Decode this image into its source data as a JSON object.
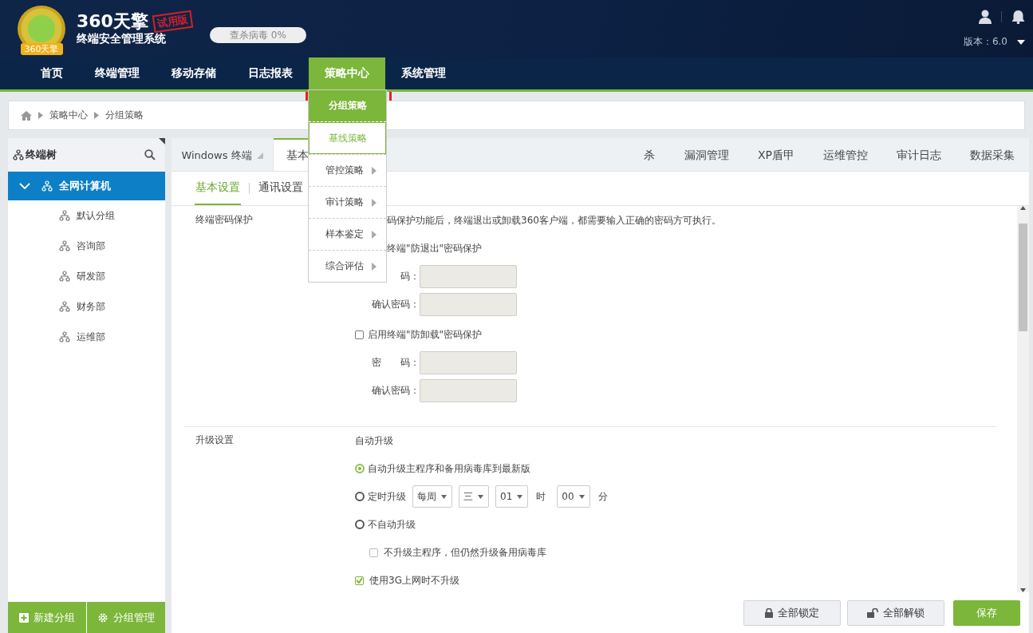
{
  "header": {
    "logo_badge": "360天擎",
    "logo_title": "360天擎",
    "logo_subtitle": "终端安全管理系统",
    "stamp": "试用版",
    "scan": {
      "label": "查杀病毒 0%",
      "level": 0
    },
    "version": "版本：6.0"
  },
  "nav": [
    {
      "label": "首页",
      "selected": false
    },
    {
      "label": "终端管理",
      "selected": false
    },
    {
      "label": "移动存储",
      "selected": false
    },
    {
      "label": "日志报表",
      "selected": false
    },
    {
      "label": "策略中心",
      "selected": true
    },
    {
      "label": "系统管理",
      "selected": false
    }
  ],
  "nav_menu": [
    {
      "label": "分组策略",
      "selected": true,
      "highlighted": false,
      "submenu": false
    },
    {
      "label": "基线策略",
      "selected": false,
      "highlighted": true,
      "submenu": false
    },
    {
      "label": "管控策略",
      "selected": false,
      "highlighted": false,
      "submenu": true
    },
    {
      "label": "审计策略",
      "selected": false,
      "highlighted": false,
      "submenu": true
    },
    {
      "label": "样本鉴定",
      "selected": false,
      "highlighted": false,
      "submenu": true
    },
    {
      "label": "综合评估",
      "selected": false,
      "highlighted": false,
      "submenu": true
    }
  ],
  "breadcrumb": [
    "策略中心",
    "分组策略"
  ],
  "sidebar": {
    "title": "终端树",
    "tree": [
      {
        "label": "全网计算机",
        "selected": true,
        "expanded": true,
        "children": [
          {
            "label": "默认分组",
            "selected": false
          },
          {
            "label": "咨询部",
            "selected": false
          },
          {
            "label": "研发部",
            "selected": false
          },
          {
            "label": "财务部",
            "selected": false
          },
          {
            "label": "运维部",
            "selected": false
          }
        ]
      }
    ],
    "buttons": [
      {
        "label": "新建分组",
        "kind": "add"
      },
      {
        "label": "分组管理",
        "kind": "settings"
      }
    ]
  },
  "tabs": [
    {
      "label": "Windows 终端",
      "selected": false,
      "kind": "dropdown"
    },
    {
      "label": "基本",
      "selected": true,
      "kind": "plain"
    },
    {
      "label": "杀",
      "selected": false,
      "kind": "partly_hidden"
    },
    {
      "label": "漏洞管理",
      "selected": false,
      "kind": "plain"
    },
    {
      "label": "XP盾甲",
      "selected": false,
      "kind": "plain"
    },
    {
      "label": "运维管控",
      "selected": false,
      "kind": "plain"
    },
    {
      "label": "审计日志",
      "selected": false,
      "kind": "plain"
    },
    {
      "label": "数据采集",
      "selected": false,
      "kind": "plain"
    }
  ],
  "subtabs": [
    {
      "label": "基本设置",
      "selected": true
    },
    {
      "label": "通讯设置",
      "selected": false
    }
  ],
  "password_section": {
    "label": "终端密码保护",
    "note": "码保护功能后，终端退出或卸载360客户端，都需要输入正确的密码方可执行。",
    "groups": [
      {
        "label": "终端\"防退出\"密码保护",
        "fields": [
          {
            "label": "码："
          },
          {
            "label": "确认密码："
          }
        ]
      },
      {
        "label": "启用终端\"防卸载\"密码保护",
        "checked": false,
        "fields": [
          {
            "label": "密　　码："
          },
          {
            "label": "确认密码："
          }
        ]
      }
    ]
  },
  "upgrade_section": {
    "label": "升级设置",
    "heading": "自动升级",
    "options": [
      {
        "kind": "radio",
        "label": "自动升级主程序和备用病毒库到最新版",
        "selected": true
      },
      {
        "kind": "radio",
        "label": "定时升级",
        "selected": false,
        "schedule": [
          {
            "value": "每周"
          },
          {
            "value": "三"
          },
          {
            "value": "01",
            "suffix": "时"
          },
          {
            "value": "00",
            "suffix": "分"
          }
        ]
      },
      {
        "kind": "radio",
        "label": "不自动升级",
        "selected": false,
        "children": [
          {
            "kind": "checkbox",
            "label": "不升级主程序，但仍然升级备用病毒库",
            "checked": false
          }
        ]
      },
      {
        "kind": "checkbox",
        "label": "使用3G上网时不升级",
        "checked": true
      }
    ]
  },
  "actions": [
    {
      "label": "全部锁定",
      "kind": "lock"
    },
    {
      "label": "全部解锁",
      "kind": "unlock"
    },
    {
      "label": "保存",
      "kind": "primary"
    }
  ]
}
